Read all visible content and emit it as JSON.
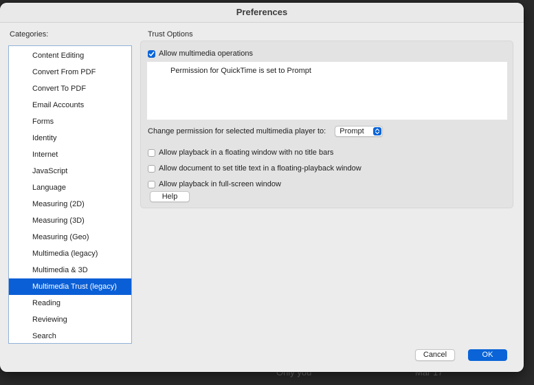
{
  "window": {
    "title": "Preferences"
  },
  "backdrop": {
    "left_text": "Only you",
    "right_text": "Mar 17"
  },
  "sidebar": {
    "label": "Categories:",
    "items": [
      {
        "label": "Content Editing",
        "selected": false
      },
      {
        "label": "Convert From PDF",
        "selected": false
      },
      {
        "label": "Convert To PDF",
        "selected": false
      },
      {
        "label": "Email Accounts",
        "selected": false
      },
      {
        "label": "Forms",
        "selected": false
      },
      {
        "label": "Identity",
        "selected": false
      },
      {
        "label": "Internet",
        "selected": false
      },
      {
        "label": "JavaScript",
        "selected": false
      },
      {
        "label": "Language",
        "selected": false
      },
      {
        "label": "Measuring (2D)",
        "selected": false
      },
      {
        "label": "Measuring (3D)",
        "selected": false
      },
      {
        "label": "Measuring (Geo)",
        "selected": false
      },
      {
        "label": "Multimedia (legacy)",
        "selected": false
      },
      {
        "label": "Multimedia & 3D",
        "selected": false
      },
      {
        "label": "Multimedia Trust (legacy)",
        "selected": true
      },
      {
        "label": "Reading",
        "selected": false
      },
      {
        "label": "Reviewing",
        "selected": false
      },
      {
        "label": "Search",
        "selected": false
      }
    ]
  },
  "trust_options": {
    "group_label": "Trust Options",
    "allow_multimedia": {
      "label": "Allow multimedia operations",
      "checked": true
    },
    "permission_text": "Permission for QuickTime is set to Prompt",
    "change_permission_label": "Change permission for selected multimedia player to:",
    "permission_select_value": "Prompt",
    "options": [
      {
        "label": "Allow playback in a floating window with no title bars",
        "checked": false
      },
      {
        "label": "Allow document to set title text in a floating-playback window",
        "checked": false
      },
      {
        "label": "Allow playback in full-screen window",
        "checked": false
      }
    ],
    "help_label": "Help"
  },
  "footer": {
    "cancel_label": "Cancel",
    "ok_label": "OK"
  },
  "colors": {
    "accent": "#0a64d8",
    "selection": "#0a5fd6",
    "window_bg": "#ececec",
    "backdrop": "#2a2a2a"
  }
}
